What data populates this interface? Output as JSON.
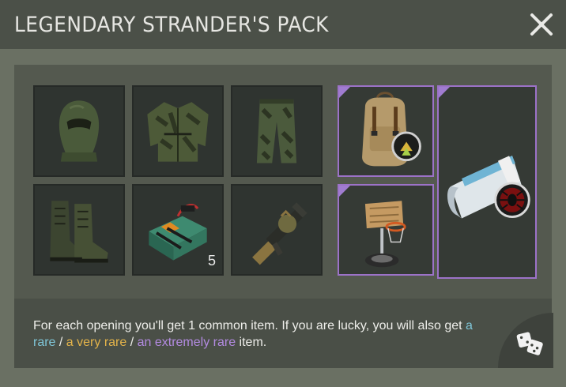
{
  "header": {
    "title": "LEGENDARY STRANDER'S PACK"
  },
  "footer": {
    "text_1": "For each opening you'll get 1 common item. If you are lucky, you will also get ",
    "rare": "a rare",
    "sep_1": " / ",
    "very_rare": "a very rare",
    "sep_2": " / ",
    "extremely_rare": "an extremely rare",
    "text_2": " item."
  },
  "items": {
    "common": [
      {
        "name": "balaclava",
        "icon": "balaclava-icon"
      },
      {
        "name": "ghillie jacket",
        "icon": "jacket-icon"
      },
      {
        "name": "camo pants",
        "icon": "pants-icon"
      },
      {
        "name": "boots",
        "icon": "boots-icon"
      },
      {
        "name": "c4 explosive",
        "icon": "c4-icon",
        "quantity": "5"
      },
      {
        "name": "grenade launcher",
        "icon": "grenade-launcher-icon"
      }
    ],
    "rare": [
      {
        "name": "backpack",
        "icon": "backpack-icon",
        "badge": "rank-badge-icon"
      },
      {
        "name": "basketball hoop",
        "icon": "basketball-hoop-icon"
      },
      {
        "name": "magazine",
        "icon": "magazine-icon",
        "badge": "spider-badge-icon"
      }
    ]
  },
  "colors": {
    "rare": "#7fc6d8",
    "very_rare": "#e3b34a",
    "extremely_rare": "#b28ae0",
    "rare_border": "#9c72c8"
  }
}
